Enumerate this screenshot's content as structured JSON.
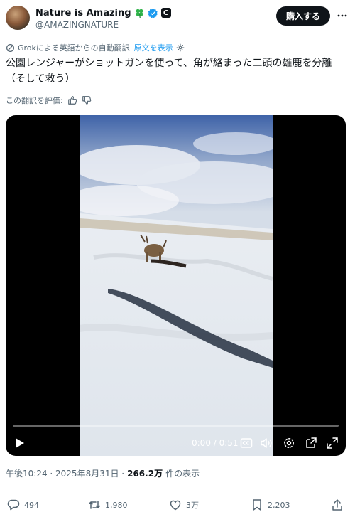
{
  "author": {
    "display_name": "Nature is Amazing",
    "handle": "@AMAZINGNATURE",
    "affiliate_badge": "C",
    "icons": [
      "clover-icon",
      "verified-icon"
    ]
  },
  "header": {
    "buy_label": "購入する"
  },
  "translation": {
    "label": "Grokによる英語からの自動翻訳",
    "show_original": "原文を表示"
  },
  "tweet": {
    "text": "公園レンジャーがショットガンを使って、角が絡まった二頭の雄鹿を分離（そして救う）"
  },
  "rating": {
    "label": "この翻訳を評価:"
  },
  "video": {
    "time": "0:00 / 0:51",
    "progress_fraction": 0
  },
  "meta": {
    "timestamp": "午後10:24 · 2025年8月31日 ·",
    "views_count": "266.2万",
    "views_label": "件の表示"
  },
  "actions": {
    "replies": "494",
    "reposts": "1,980",
    "likes": "3万",
    "bookmarks": "2,203"
  },
  "colors": {
    "accent": "#1d9bf0",
    "text": "#0f1419",
    "muted": "#536471",
    "button_dark": "#0f1419"
  }
}
